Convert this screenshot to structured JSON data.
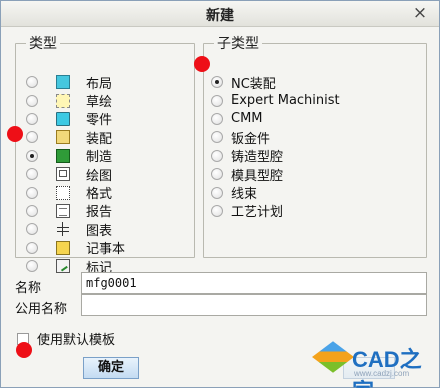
{
  "dialog": {
    "title": "新建",
    "close_glyph": "×"
  },
  "type_group": {
    "legend": "类型",
    "selected_index": 4,
    "items": [
      {
        "label": "布局",
        "icon": "layout-icon"
      },
      {
        "label": "草绘",
        "icon": "sketch-icon"
      },
      {
        "label": "零件",
        "icon": "part-icon"
      },
      {
        "label": "装配",
        "icon": "assembly-icon"
      },
      {
        "label": "制造",
        "icon": "manufacturing-icon"
      },
      {
        "label": "绘图",
        "icon": "drawing-icon"
      },
      {
        "label": "格式",
        "icon": "format-icon"
      },
      {
        "label": "报告",
        "icon": "report-icon"
      },
      {
        "label": "图表",
        "icon": "diagram-icon"
      },
      {
        "label": "记事本",
        "icon": "notebook-icon"
      },
      {
        "label": "标记",
        "icon": "markup-icon"
      }
    ]
  },
  "subtype_group": {
    "legend": "子类型",
    "selected_index": 0,
    "items": [
      {
        "label": "NC装配"
      },
      {
        "label": "Expert Machinist"
      },
      {
        "label": "CMM"
      },
      {
        "label": "钣金件"
      },
      {
        "label": "铸造型腔"
      },
      {
        "label": "模具型腔"
      },
      {
        "label": "线束"
      },
      {
        "label": "工艺计划"
      }
    ]
  },
  "name_field": {
    "label": "名称",
    "value": "mfg0001"
  },
  "common_name_field": {
    "label": "公用名称",
    "value": ""
  },
  "default_template": {
    "label": "使用默认模板",
    "checked": false
  },
  "buttons": {
    "ok_label": "确定"
  },
  "watermark": {
    "brand": "CAD之家",
    "url": "www.cadzj.com"
  },
  "colors": {
    "marker": "#ee0f17",
    "title_bar": "#e9e9e4",
    "ok_button": "#c3dbf2"
  }
}
